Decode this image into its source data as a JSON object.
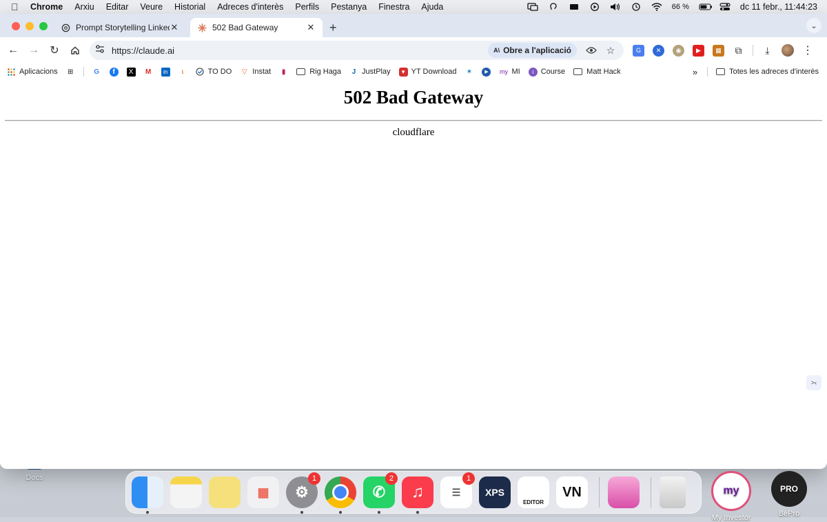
{
  "menubar": {
    "app_name": "Chrome",
    "items": [
      "Arxiu",
      "Editar",
      "Veure",
      "Historial",
      "Adreces d'interès",
      "Perfils",
      "Pestanya",
      "Finestra",
      "Ajuda"
    ],
    "battery": "66 %",
    "datetime": "dc 11 febr., 11:44:23"
  },
  "tabs": [
    {
      "title": "Prompt Storytelling LinkedIn",
      "icon": "openai-icon",
      "active": false
    },
    {
      "title": "502 Bad Gateway",
      "icon": "claude-icon",
      "active": true
    }
  ],
  "toolbar": {
    "url": "https://claude.ai",
    "open_app_label": "Obre a l'aplicació",
    "open_app_logo": "A\\"
  },
  "bookmarks": {
    "items": [
      {
        "label": "Aplicacions",
        "icon": "apps-grid-icon"
      },
      {
        "label": "",
        "icon": "google-icon"
      },
      {
        "label": "",
        "icon": "facebook-icon"
      },
      {
        "label": "",
        "icon": "x-icon"
      },
      {
        "label": "",
        "icon": "gmail-icon"
      },
      {
        "label": "",
        "icon": "linkedin-icon"
      },
      {
        "label": "",
        "icon": "figure-icon"
      },
      {
        "label": "TO DO",
        "icon": "check-circle-icon"
      },
      {
        "label": "Instat",
        "icon": "instat-icon"
      },
      {
        "label": "",
        "icon": "tag-icon"
      },
      {
        "label": "Rig Haga",
        "icon": "folder-icon"
      },
      {
        "label": "JustPlay",
        "icon": "justplay-icon"
      },
      {
        "label": "YT Download",
        "icon": "yt-download-icon"
      },
      {
        "label": "",
        "icon": "caixabank-icon"
      },
      {
        "label": "",
        "icon": "play-circle-icon"
      },
      {
        "label": "MI",
        "icon": "my-icon"
      },
      {
        "label": "Course",
        "icon": "course-icon"
      },
      {
        "label": "Matt Hack",
        "icon": "folder-icon"
      }
    ],
    "all_bookmarks_label": "Totes les adreces d'interès"
  },
  "page": {
    "heading": "502 Bad Gateway",
    "server": "cloudflare"
  },
  "desktop": {
    "docs_label": "Docs",
    "right_apps": [
      {
        "label": "My Investor",
        "logo": "my"
      },
      {
        "label": "BePro",
        "logo": "PRO"
      }
    ]
  },
  "dock": {
    "apps": [
      {
        "name": "Finder",
        "badge": "",
        "running": true
      },
      {
        "name": "Notes",
        "badge": "",
        "running": false
      },
      {
        "name": "Stickies",
        "badge": "",
        "running": false
      },
      {
        "name": "Launchpad",
        "badge": "",
        "running": false
      },
      {
        "name": "System Settings",
        "badge": "1",
        "running": true
      },
      {
        "name": "Chrome",
        "badge": "",
        "running": true
      },
      {
        "name": "WhatsApp",
        "badge": "2",
        "running": true
      },
      {
        "name": "Music",
        "badge": "",
        "running": true
      },
      {
        "name": "Reminders",
        "badge": "1",
        "running": false
      },
      {
        "name": "XPS",
        "badge": "",
        "running": false,
        "text": "XPS"
      },
      {
        "name": "Editor",
        "badge": "",
        "running": false,
        "text": "EDITOR"
      },
      {
        "name": "VN",
        "badge": "",
        "running": false,
        "text": "VN"
      },
      {
        "name": "CleanMyMac",
        "badge": "",
        "running": false
      },
      {
        "name": "Trash",
        "badge": "",
        "running": false
      }
    ]
  }
}
